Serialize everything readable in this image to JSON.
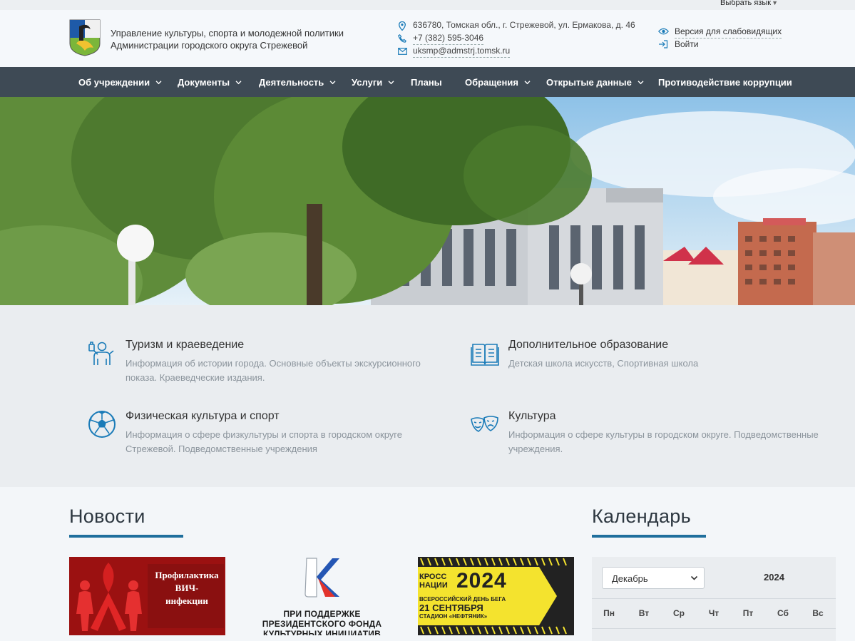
{
  "topbar": {
    "language_label": "Выбрать язык"
  },
  "header": {
    "org_line1": "Управление культуры, спорта и молодежной политики",
    "org_line2": "Администрации городского округа Стрежевой",
    "address": "636780, Томская обл., г. Стрежевой, ул. Ермакова, д. 46",
    "phone": "+7 (382) 595-3046",
    "email": "uksmp@admstrj.tomsk.ru",
    "accessibility_label": "Версия для слабовидящих",
    "login_label": "Войти"
  },
  "nav": {
    "items": [
      {
        "label": "Об учреждении",
        "has_dropdown": true
      },
      {
        "label": "Документы",
        "has_dropdown": true
      },
      {
        "label": "Деятельность",
        "has_dropdown": true
      },
      {
        "label": "Услуги",
        "has_dropdown": true
      },
      {
        "label": "Планы",
        "has_dropdown": false
      },
      {
        "label": "Обращения",
        "has_dropdown": true
      },
      {
        "label": "Открытые данные",
        "has_dropdown": true
      },
      {
        "label": "Противодействие коррупции",
        "has_dropdown": false
      }
    ]
  },
  "features": [
    {
      "icon": "tourism-guide-icon",
      "title": "Туризм и краеведение",
      "description": "Информация об истории города. Основные объекты экскурсионного показа. Краеведческие издания."
    },
    {
      "icon": "open-book-icon",
      "title": "Дополнительное образование",
      "description": "Детская школа искусств, Спортивная школа"
    },
    {
      "icon": "soccer-ball-icon",
      "title": "Физическая культура и спорт",
      "description": "Информация о сфере физкультуры и спорта в городском округе Стрежевой. Подведомственные учреждения"
    },
    {
      "icon": "theatre-masks-icon",
      "title": "Культура",
      "description": "Информация о сфере культуры в городском округе. Подведомственные учреждения."
    }
  ],
  "news": {
    "title": "Новости",
    "cards": [
      {
        "caption_line1": "Профилактика",
        "caption_line2": "ВИЧ-",
        "caption_line3": "инфекции"
      },
      {
        "caption_line1": "ПРИ ПОДДЕРЖКЕ",
        "caption_line2": "ПРЕЗИДЕНТСКОГО ФОНДА",
        "caption_line3": "КУЛЬТУРНЫХ ИНИЦИАТИВ"
      },
      {
        "caption_line1": "КРОСС",
        "caption_line2": "НАЦИИ",
        "caption_line3": "2024",
        "caption_line4": "ВСЕРОССИЙСКИЙ ДЕНЬ БЕГА",
        "caption_line5": "21 СЕНТЯБРЯ",
        "caption_line6": "СТАДИОН «НЕФТЯНИК»"
      }
    ]
  },
  "calendar": {
    "title": "Календарь",
    "month": "Декабрь",
    "year": "2024",
    "weekdays": [
      "Пн",
      "Вт",
      "Ср",
      "Чт",
      "Пт",
      "Сб",
      "Вс"
    ]
  },
  "colors": {
    "nav_bg": "#3e4a55",
    "accent": "#1f6f9d",
    "icon_blue": "#1a7bb8"
  }
}
